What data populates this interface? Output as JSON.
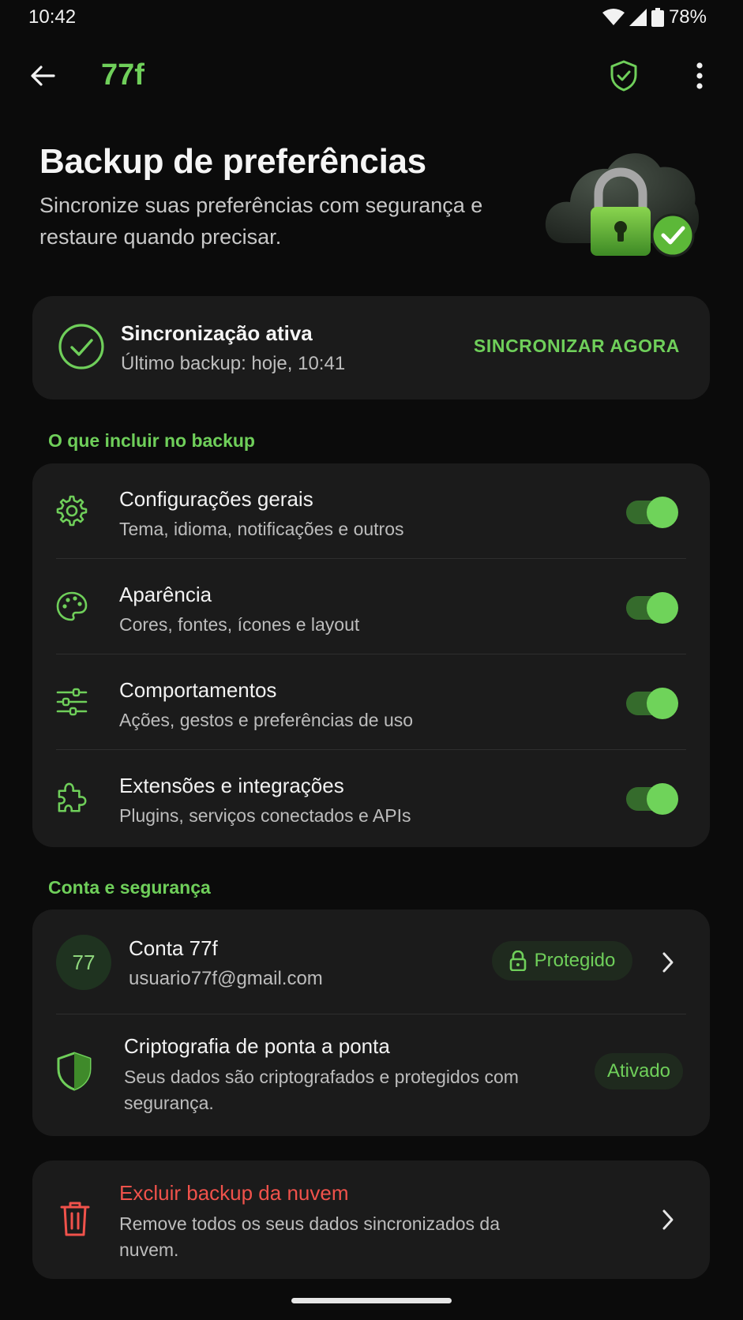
{
  "status": {
    "time": "10:42",
    "battery": "78%"
  },
  "app_bar": {
    "title": "77f"
  },
  "hero": {
    "title": "Backup de preferências",
    "subtitle": "Sincronize suas preferências com segurança e restaure quando precisar."
  },
  "sync": {
    "title": "Sincronização ativa",
    "subtitle": "Último backup: hoje, 10:41",
    "action": "SINCRONIZAR AGORA"
  },
  "include_section": {
    "label": "O que incluir no backup",
    "items": [
      {
        "title": "Configurações gerais",
        "subtitle": "Tema, idioma, notificações e outros",
        "enabled": true,
        "icon": "gear-icon"
      },
      {
        "title": "Aparência",
        "subtitle": "Cores, fontes, ícones e layout",
        "enabled": true,
        "icon": "palette-icon"
      },
      {
        "title": "Comportamentos",
        "subtitle": "Ações, gestos e preferências de uso",
        "enabled": true,
        "icon": "sliders-icon"
      },
      {
        "title": "Extensões e integrações",
        "subtitle": "Plugins, serviços conectados e APIs",
        "enabled": true,
        "icon": "puzzle-icon"
      }
    ]
  },
  "account_section": {
    "label": "Conta e segurança",
    "account": {
      "avatar": "77",
      "title": "Conta 77f",
      "email": "usuario77f@gmail.com",
      "badge": "Protegido"
    },
    "encryption": {
      "title": "Criptografia de ponta a ponta",
      "subtitle": "Seus dados são criptografados e protegidos com segurança.",
      "badge": "Ativado"
    }
  },
  "delete": {
    "title": "Excluir backup da nuvem",
    "subtitle": "Remove todos os seus dados sincronizados da nuvem."
  },
  "colors": {
    "accent": "#6fcf5a",
    "danger": "#f0524b",
    "card": "#1b1b1b",
    "background": "#0b0b0b"
  }
}
